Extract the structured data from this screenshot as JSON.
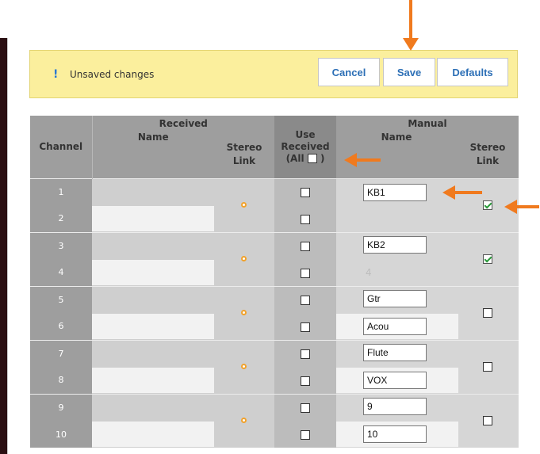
{
  "notice": {
    "icon": "exclamation-icon",
    "mark": "!",
    "message": "Unsaved changes",
    "buttons": {
      "cancel": "Cancel",
      "save": "Save",
      "defaults": "Defaults"
    }
  },
  "headers": {
    "channel": "Channel",
    "received": "Received",
    "received_name": "Name",
    "received_stereo_1": "Stereo",
    "received_stereo_2": "Link",
    "use_received_1": "Use",
    "use_received_2": "Received",
    "use_received_all_open": "(All",
    "use_received_all_close": ")",
    "manual": "Manual",
    "manual_name": "Name",
    "manual_stereo_1": "Stereo",
    "manual_stereo_2": "Link"
  },
  "colors": {
    "accent": "#2c6fb6",
    "notice_bg": "#fbef9d",
    "arrow": "#f07a1e",
    "check": "#2a9a3a",
    "stereo_ring": "#f1a22c"
  },
  "channels": [
    {
      "n": "1",
      "use_received": false,
      "manual_value": "KB1"
    },
    {
      "n": "2",
      "use_received": false,
      "manual_value": null
    },
    {
      "n": "3",
      "use_received": false,
      "manual_value": "KB2"
    },
    {
      "n": "4",
      "use_received": false,
      "manual_value": null,
      "manual_ghost": "4"
    },
    {
      "n": "5",
      "use_received": false,
      "manual_value": "Gtr"
    },
    {
      "n": "6",
      "use_received": false,
      "manual_value": "Acou"
    },
    {
      "n": "7",
      "use_received": false,
      "manual_value": "Flute"
    },
    {
      "n": "8",
      "use_received": false,
      "manual_value": "VOX"
    },
    {
      "n": "9",
      "use_received": false,
      "manual_value": "9"
    },
    {
      "n": "10",
      "use_received": false,
      "manual_value": "10"
    }
  ],
  "pairs_stereo_manual": [
    true,
    true,
    false,
    false,
    false
  ]
}
